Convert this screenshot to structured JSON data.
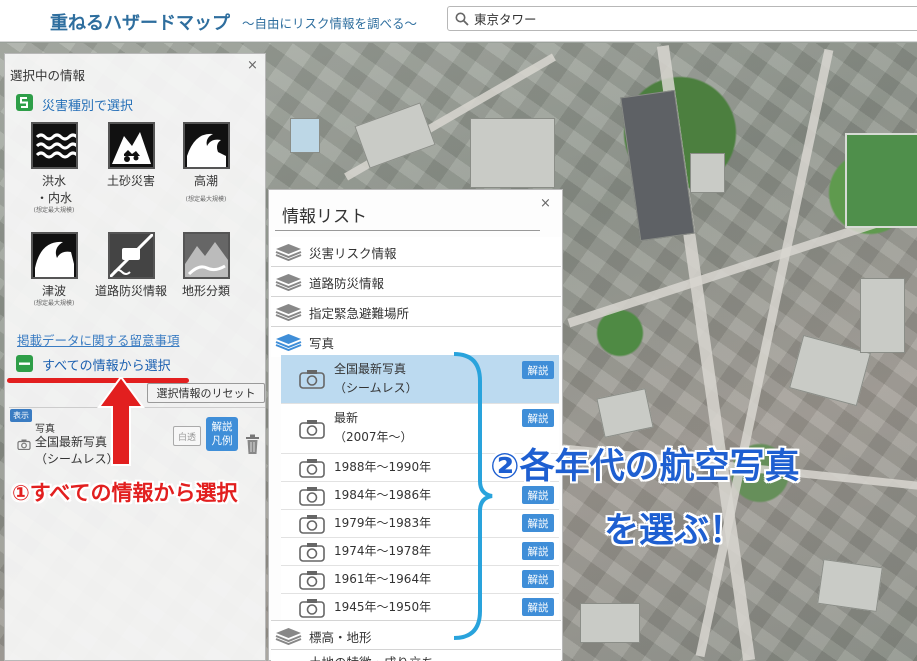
{
  "header": {
    "title": "重ねるハザードマップ",
    "subtitle": "～自由にリスク情報を調べる～",
    "search_value": "東京タワー"
  },
  "left_panel": {
    "title": "選択中の情報",
    "close": "×",
    "section_disaster": "災害種別で選択",
    "hazards": [
      {
        "label": "洪水",
        "label2": "・内水",
        "note": "(想定最大規模)",
        "icon": "flood-icon"
      },
      {
        "label": "土砂災害",
        "label2": "",
        "note": "",
        "icon": "landslide-icon"
      },
      {
        "label": "高潮",
        "label2": "",
        "note": "(想定最大規模)",
        "icon": "storm-surge-icon"
      },
      {
        "label": "津波",
        "label2": "",
        "note": "(想定最大規模)",
        "icon": "tsunami-icon"
      },
      {
        "label": "道路防災情報",
        "label2": "",
        "note": "",
        "icon": "road-disaster-icon"
      },
      {
        "label": "地形分類",
        "label2": "",
        "note": "",
        "icon": "terrain-icon"
      }
    ],
    "notice_link": "掲載データに関する留意事項",
    "section_all": "すべての情報から選択",
    "reset_button": "選択情報のリセット",
    "selected": {
      "badge": "表示",
      "category": "写真",
      "name_line1": "全国最新写真",
      "name_line2": "（シームレス）",
      "transparency_button": "白透",
      "legend_line1": "解説",
      "legend_line2": "凡例"
    }
  },
  "info_list": {
    "title": "情報リスト",
    "close": "×",
    "categories": {
      "c1": "災害リスク情報",
      "c2": "道路防災情報",
      "c3": "指定緊急避難場所",
      "c4": "写真",
      "c5": "標高・地形",
      "c6": "土地の特徴・成り立ち"
    },
    "kaisetsu": "解説",
    "photos": [
      {
        "line1": "全国最新写真",
        "line2": "（シームレス）"
      },
      {
        "line1": "最新",
        "line2": "（2007年～）"
      },
      {
        "line1": "1988年～1990年",
        "line2": ""
      },
      {
        "line1": "1984年～1986年",
        "line2": ""
      },
      {
        "line1": "1979年～1983年",
        "line2": ""
      },
      {
        "line1": "1974年～1978年",
        "line2": ""
      },
      {
        "line1": "1961年～1964年",
        "line2": ""
      },
      {
        "line1": "1945年～1950年",
        "line2": ""
      }
    ]
  },
  "annotations": {
    "step1": "①すべての情報から選択",
    "step2_line1": "②各年代の航空写真",
    "step2_line2": "を選ぶ！"
  },
  "colors": {
    "accent": "#3f8ed8",
    "title": "#2e6e9e",
    "annotation_red": "#e21f1f",
    "annotation_blue": "#1e5fd1",
    "selected_row": "#bcdaf0"
  }
}
